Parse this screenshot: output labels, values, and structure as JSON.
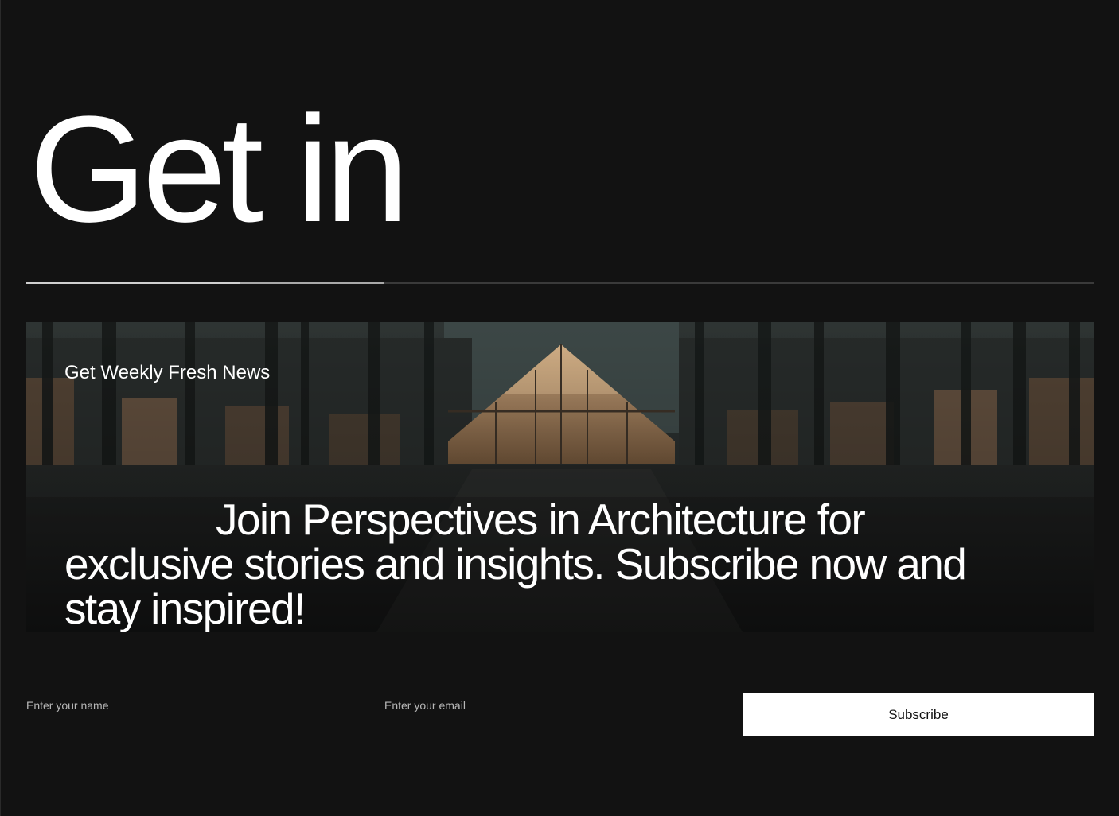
{
  "hero": {
    "title": "Get in"
  },
  "progress": {
    "fraction": 0.335,
    "segment_end_fraction": 0.2
  },
  "newsletter": {
    "kicker": "Get Weekly Fresh News",
    "message": "Join Perspectives in Architecture for exclusive stories and insights. Subscribe now and stay inspired!",
    "background_image": "glass-pavilion-at-dusk-photo"
  },
  "form": {
    "name_placeholder": "Enter your name",
    "email_placeholder": "Enter your email",
    "subscribe_label": "Subscribe"
  },
  "colors": {
    "background": "#121212",
    "button_bg": "#ffffff",
    "button_text": "#111111",
    "progress_fill": "#a9a9a9",
    "progress_track": "#3a3a3a"
  }
}
